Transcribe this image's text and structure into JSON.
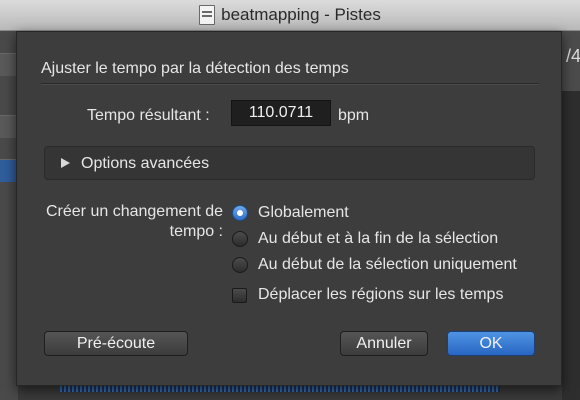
{
  "window": {
    "title": "beatmapping - Pistes"
  },
  "dialog": {
    "title": "Ajuster le tempo par la détection des temps",
    "tempo": {
      "label": "Tempo résultant :",
      "value": "110.0711",
      "unit": "bpm"
    },
    "advanced_options": {
      "label": "Options avancées",
      "expanded": false
    },
    "tempo_change": {
      "label": "Créer un changement de tempo :",
      "options": [
        {
          "label": "Globalement",
          "selected": true
        },
        {
          "label": "Au début et à la fin de la sélection",
          "selected": false
        },
        {
          "label": "Au début de la sélection uniquement",
          "selected": false
        }
      ]
    },
    "move_regions": {
      "label": "Déplacer les régions sur les temps",
      "checked": false
    },
    "buttons": {
      "preview": "Pré-écoute",
      "cancel": "Annuler",
      "ok": "OK"
    }
  },
  "colors": {
    "accent": "#2e6fc8",
    "sheet_background": "#3d3d3d",
    "text": "#e6e6e6"
  },
  "icons": {
    "document": "document-icon",
    "disclosure": "disclosure-triangle-icon"
  }
}
